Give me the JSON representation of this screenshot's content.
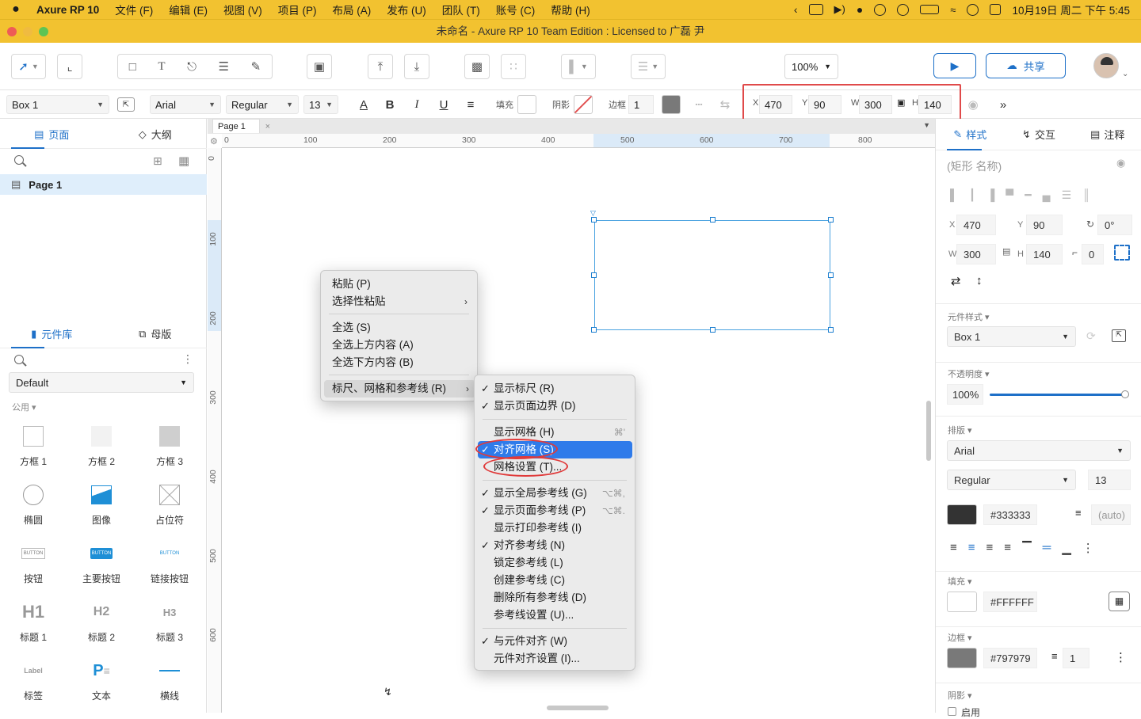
{
  "menubar": {
    "app_name": "Axure RP 10",
    "items": [
      "文件 (F)",
      "编辑 (E)",
      "视图 (V)",
      "项目 (P)",
      "布局 (A)",
      "发布 (U)",
      "团队 (T)",
      "账号 (C)",
      "帮助 (H)"
    ],
    "clock": "10月19日 周二 下午 5:45"
  },
  "window": {
    "title": "未命名 - Axure RP 10 Team Edition : Licensed to 广磊 尹"
  },
  "toolbar": {
    "zoom": "100%",
    "share_label": "共享"
  },
  "formatbar": {
    "style_name": "Box 1",
    "font_family": "Arial",
    "font_weight": "Regular",
    "font_size": "13",
    "fill_label": "填充",
    "shadow_label": "阴影",
    "border_label": "边框",
    "border_width": "1",
    "x_label": "X",
    "x": "470",
    "y_label": "Y",
    "y": "90",
    "w_label": "W",
    "w": "300",
    "h_label": "H",
    "h": "140"
  },
  "left_panel": {
    "pages_tab": "页面",
    "outline_tab": "大纲",
    "page_name": "Page 1",
    "library_tab": "元件库",
    "masters_tab": "母版",
    "library_select": "Default",
    "category": "公用",
    "widgets": [
      {
        "label": "方框 1"
      },
      {
        "label": "方框 2"
      },
      {
        "label": "方框 3"
      },
      {
        "label": "椭圆"
      },
      {
        "label": "图像"
      },
      {
        "label": "占位符"
      },
      {
        "label": "按钮"
      },
      {
        "label": "主要按钮"
      },
      {
        "label": "链接按钮"
      },
      {
        "label": "标题 1"
      },
      {
        "label": "标题 2"
      },
      {
        "label": "标题 3"
      },
      {
        "label": "标签"
      },
      {
        "label": "文本"
      },
      {
        "label": "横线"
      }
    ],
    "widget_thumb_text": {
      "button": "BUTTON",
      "h1": "H1",
      "h2": "H2",
      "h3": "H3",
      "label": "Label",
      "para": "P"
    }
  },
  "canvas": {
    "doc_tab": "Page 1",
    "h_ruler": [
      "0",
      "100",
      "200",
      "300",
      "400",
      "500",
      "600",
      "700",
      "800"
    ],
    "v_ruler": [
      "0",
      "100",
      "200",
      "300",
      "400",
      "500",
      "600"
    ]
  },
  "context_menu": {
    "items": [
      "粘贴 (P)",
      "选择性粘贴",
      "全选 (S)",
      "全选上方内容 (A)",
      "全选下方内容 (B)",
      "标尺、网格和参考线 (R)"
    ]
  },
  "submenu": {
    "items": [
      {
        "label": "显示标尺 (R)",
        "checked": true,
        "shortcut": ""
      },
      {
        "label": "显示页面边界 (D)",
        "checked": true,
        "shortcut": ""
      },
      {
        "label": "显示网格 (H)",
        "checked": false,
        "shortcut": "⌘'"
      },
      {
        "label": "对齐网格 (S)",
        "checked": true,
        "shortcut": ""
      },
      {
        "label": "网格设置 (T)...",
        "checked": false,
        "shortcut": ""
      },
      {
        "label": "显示全局参考线 (G)",
        "checked": true,
        "shortcut": "⌥⌘,"
      },
      {
        "label": "显示页面参考线 (P)",
        "checked": true,
        "shortcut": "⌥⌘."
      },
      {
        "label": "显示打印参考线 (I)",
        "checked": false,
        "shortcut": ""
      },
      {
        "label": "对齐参考线 (N)",
        "checked": true,
        "shortcut": ""
      },
      {
        "label": "锁定参考线 (L)",
        "checked": false,
        "shortcut": ""
      },
      {
        "label": "创建参考线 (C)",
        "checked": false,
        "shortcut": ""
      },
      {
        "label": "删除所有参考线 (D)",
        "checked": false,
        "shortcut": ""
      },
      {
        "label": "参考线设置 (U)...",
        "checked": false,
        "shortcut": ""
      },
      {
        "label": "与元件对齐 (W)",
        "checked": true,
        "shortcut": ""
      },
      {
        "label": "元件对齐设置 (I)...",
        "checked": false,
        "shortcut": ""
      }
    ],
    "check_glyph": "✓"
  },
  "right_panel": {
    "style_tab": "样式",
    "interaction_tab": "交互",
    "notes_tab": "注释",
    "name_placeholder": "(矩形 名称)",
    "x_label": "X",
    "x": "470",
    "y_label": "Y",
    "y": "90",
    "rotation": "0°",
    "w_label": "W",
    "w": "300",
    "h_label": "H",
    "h": "140",
    "radius": "0",
    "style_section": "元件样式",
    "style_value": "Box 1",
    "opacity_section": "不透明度",
    "opacity": "100%",
    "opacity_fraction": 1.0,
    "typography_section": "排版",
    "font_family": "Arial",
    "font_weight": "Regular",
    "font_size": "13",
    "text_color": "#333333",
    "line_height": "(auto)",
    "fill_section": "填充",
    "fill_color": "#FFFFFF",
    "border_section": "边框",
    "border_color": "#797979",
    "border_width": "1",
    "shadow_section": "阴影",
    "shadow_enable": "启用"
  },
  "colors": {
    "accent": "#1e70c8",
    "menubar": "#f2c230",
    "selection": "#2f7bea",
    "annotation": "#e03a3a",
    "text_swatch": "#333333",
    "border_swatch": "#797979"
  }
}
